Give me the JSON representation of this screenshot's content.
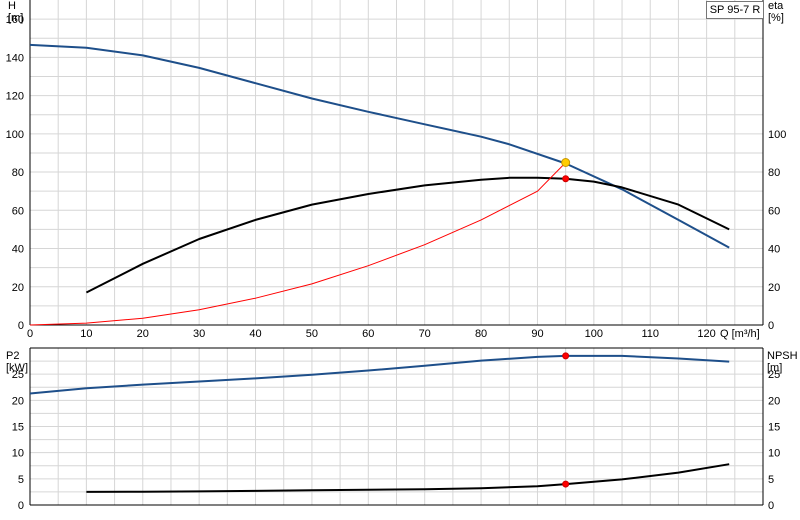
{
  "chart_data": [
    {
      "type": "line",
      "title": "SP 95-7 R",
      "xlabel": "Q [m³/h]",
      "ylabel": "H\n[m]",
      "ylabel_right": "eta\n[%]",
      "xlim": [
        0,
        130
      ],
      "ylim": [
        0,
        170
      ],
      "ylim_right": [
        0,
        170
      ],
      "x_ticks": [
        "0",
        "10",
        "20",
        "30",
        "40",
        "50",
        "60",
        "70",
        "80",
        "90",
        "100",
        "110",
        "120"
      ],
      "y_ticks": [
        "0",
        "20",
        "40",
        "60",
        "80",
        "100",
        "120",
        "140",
        "160"
      ],
      "y_ticks_right": [
        "0",
        "20",
        "40",
        "60",
        "80",
        "100"
      ],
      "grid": true,
      "series": [
        {
          "name": "",
          "axis": "left",
          "color": "#1e4f8a",
          "x": [
            0,
            10,
            20,
            30,
            40,
            50,
            60,
            70,
            80,
            85,
            95,
            105,
            115,
            124
          ],
          "y": [
            146.5,
            145,
            141,
            134.5,
            126.5,
            118.5,
            111.5,
            105,
            98.5,
            94.5,
            84.5,
            71,
            55,
            40.5
          ]
        },
        {
          "name": "",
          "axis": "right",
          "color": "#000000",
          "x": [
            10,
            20,
            30,
            40,
            50,
            60,
            70,
            80,
            85,
            90,
            95,
            100,
            105,
            115,
            124
          ],
          "y": [
            17,
            32,
            45,
            55,
            63,
            68.5,
            73,
            76,
            77,
            77,
            76.5,
            75,
            72,
            63,
            50
          ]
        },
        {
          "name": "",
          "axis": "left",
          "color": "#ff0000",
          "x": [
            0,
            10,
            20,
            30,
            40,
            50,
            60,
            70,
            80,
            90,
            95
          ],
          "y": [
            0,
            1,
            3.5,
            8,
            14,
            21.5,
            31,
            42,
            55,
            70,
            85
          ]
        }
      ],
      "points": [
        {
          "x": 95,
          "y": 85,
          "color": "#ffcc00"
        },
        {
          "x": 95,
          "y": 76.5,
          "color": "#ff0000"
        }
      ]
    },
    {
      "type": "line",
      "xlabel": "",
      "ylabel": "P2\n[kW]",
      "ylabel_right": "NPSH\n[m]",
      "xlim": [
        0,
        130
      ],
      "ylim": [
        0,
        30
      ],
      "ylim_right": [
        0,
        30
      ],
      "y_ticks": [
        "0",
        "5",
        "10",
        "15",
        "20",
        "25"
      ],
      "y_ticks_right": [
        "0",
        "5",
        "10",
        "15",
        "20",
        "25"
      ],
      "grid": true,
      "series": [
        {
          "name": "",
          "axis": "left",
          "color": "#1e4f8a",
          "x": [
            0,
            10,
            20,
            30,
            40,
            50,
            60,
            70,
            80,
            90,
            95,
            105,
            115,
            124
          ],
          "y": [
            21.3,
            22.3,
            23,
            23.6,
            24.2,
            24.9,
            25.7,
            26.6,
            27.6,
            28.3,
            28.5,
            28.5,
            28.0,
            27.4
          ]
        },
        {
          "name": "",
          "axis": "right",
          "color": "#000000",
          "x": [
            10,
            20,
            30,
            40,
            50,
            60,
            70,
            80,
            90,
            95,
            105,
            115,
            124
          ],
          "y": [
            2.5,
            2.55,
            2.6,
            2.7,
            2.8,
            2.9,
            3.0,
            3.2,
            3.6,
            4.0,
            4.9,
            6.2,
            7.8
          ]
        }
      ],
      "points": [
        {
          "x": 95,
          "y": 28.5,
          "color": "#ff0000"
        },
        {
          "x": 95,
          "y": 4.0,
          "color": "#ff0000"
        }
      ]
    }
  ]
}
